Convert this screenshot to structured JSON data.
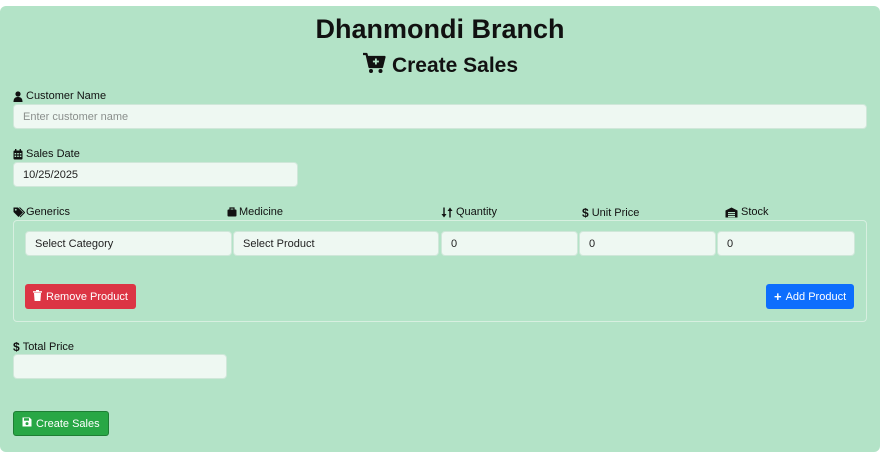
{
  "header": {
    "branch_title": "Dhanmondi Branch",
    "page_title": "Create Sales",
    "page_icon": "cart-plus-icon"
  },
  "customer": {
    "label": "Customer Name",
    "placeholder": "Enter customer name",
    "icon": "user-icon"
  },
  "sales_date": {
    "label": "Sales Date",
    "value": "10/25/2025",
    "icon": "calendar-icon"
  },
  "products": {
    "columns": [
      {
        "label": "Generics",
        "icon": "tags-icon"
      },
      {
        "label": "Medicine",
        "icon": "briefcase-icon"
      },
      {
        "label": "Quantity",
        "icon": "sort-icon"
      },
      {
        "label": "Unit Price",
        "icon": "dollar-icon"
      },
      {
        "label": "Stock",
        "icon": "warehouse-icon"
      }
    ],
    "row": {
      "generic": "Select Category",
      "medicine": "Select Product",
      "quantity": "0",
      "unit_price": "0",
      "stock": "0"
    },
    "remove_label": "Remove Product",
    "add_label": "Add Product"
  },
  "total": {
    "label": "Total Price",
    "value": "",
    "icon": "dollar-icon"
  },
  "submit": {
    "label": "Create Sales",
    "icon": "save-icon"
  },
  "colors": {
    "background": "#b3e3c7",
    "danger": "#dc3545",
    "primary": "#0d6efd",
    "success": "#28a745"
  }
}
